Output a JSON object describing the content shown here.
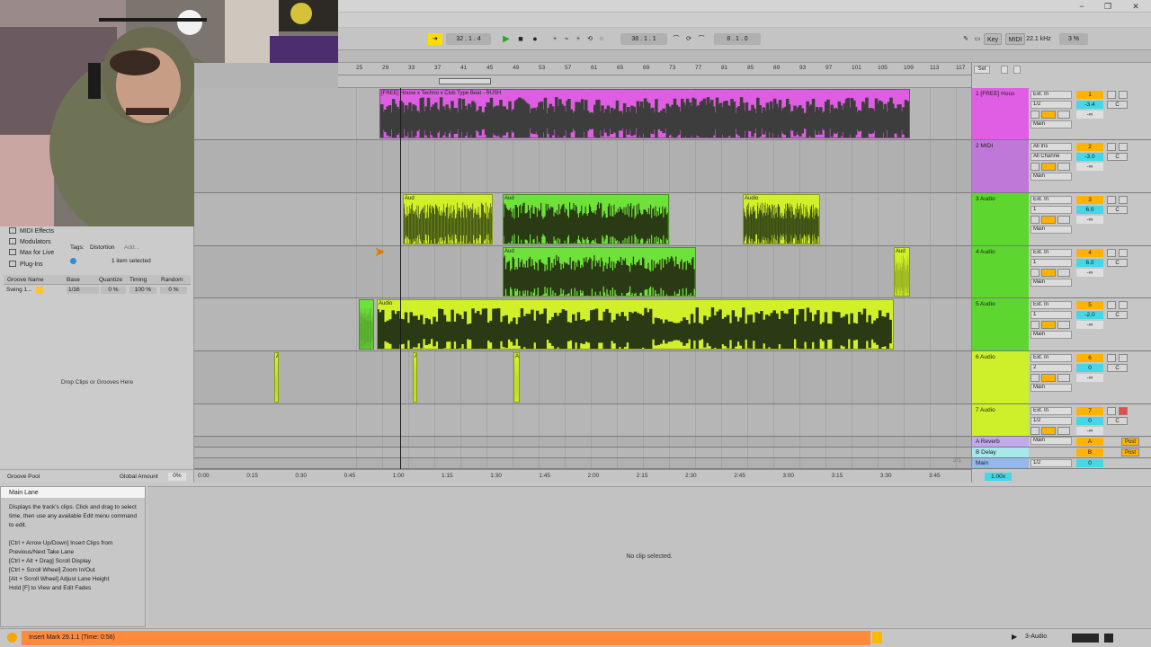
{
  "window": {
    "minimize": "−",
    "maximize": "❐",
    "close": "✕"
  },
  "transport": {
    "position": "32 .  1 .  4",
    "play_icon": "play-icon",
    "punch": "38 .  1 .  1",
    "loop_length": "8 .  1 .  0",
    "key_label": "Key",
    "midi_label": "MIDI",
    "sample_rate": "22.1 kHz",
    "cpu": "3 %"
  },
  "ruler": {
    "bars": [
      "25",
      "29",
      "33",
      "37",
      "41",
      "45",
      "49",
      "53",
      "57",
      "61",
      "65",
      "69",
      "73",
      "77",
      "81",
      "85",
      "89",
      "93",
      "97",
      "101",
      "105",
      "109",
      "113",
      "117"
    ],
    "set_label": "Set"
  },
  "timebar": {
    "times": [
      "0:00",
      "0:15",
      "0:30",
      "0:45",
      "1:00",
      "1:15",
      "1:30",
      "1:45",
      "2:00",
      "2:15",
      "2:30",
      "2:45",
      "3:00",
      "3:15",
      "3:30",
      "3:45"
    ],
    "page": "2/1"
  },
  "browser": {
    "items": [
      {
        "label": "MIDI Effects",
        "icon": "midi-effects-icon"
      },
      {
        "label": "Modulators",
        "icon": "modulators-icon"
      },
      {
        "label": "Max for Live",
        "icon": "max-for-live-icon"
      },
      {
        "label": "Plug-Ins",
        "icon": "plugins-icon"
      }
    ],
    "tags_label": "Tags:",
    "tags_value": "Distortion",
    "tags_add": "Add...",
    "selected_text": "1 item selected",
    "groove_headers": [
      "Groove Name",
      "Base",
      "Quantize",
      "Timing",
      "Random"
    ],
    "groove_row": {
      "name": "Swing 1...",
      "base": "1/16",
      "quantize": "0 %",
      "timing": "100 %",
      "random": "0 %"
    },
    "drop_text": "Drop Clips or Grooves Here",
    "groove_pool": "Groove Pool",
    "global_amount_label": "Global Amount",
    "global_amount": "0%"
  },
  "tracks": [
    {
      "name": "1 [FREE] Hous",
      "color": "#e05ee4",
      "input": "Ext. In",
      "channel": "1/2",
      "out": "Main",
      "num": "1",
      "vol": "-3.4",
      "pan": "C",
      "send": "-∞"
    },
    {
      "name": "2 MIDI",
      "color": "#c078d8",
      "input": "All Ins",
      "channel": "All Channe",
      "out": "Main",
      "num": "2",
      "vol": "-3.0",
      "pan": "C",
      "send": "-∞"
    },
    {
      "name": "3 Audio",
      "color": "#5ed630",
      "input": "Ext. In",
      "channel": "1",
      "out": "Main",
      "num": "3",
      "vol": "6.0",
      "pan": "C",
      "send": "-∞"
    },
    {
      "name": "4 Audio",
      "color": "#5ed630",
      "input": "Ext. In",
      "channel": "1",
      "out": "Main",
      "num": "4",
      "vol": "6.0",
      "pan": "C",
      "send": "-∞"
    },
    {
      "name": "5 Audio",
      "color": "#5ed630",
      "input": "Ext. In",
      "channel": "1",
      "out": "Main",
      "num": "5",
      "vol": "-2.0",
      "pan": "C",
      "send": "-∞"
    },
    {
      "name": "6 Audio",
      "color": "#cdf02a",
      "input": "Ext. In",
      "channel": "2",
      "out": "Main",
      "num": "6",
      "vol": "0",
      "pan": "C",
      "send": "-∞"
    },
    {
      "name": "7 Audio",
      "color": "#cdf02a",
      "input": "Ext. In",
      "channel": "1/2",
      "out": "Main",
      "num": "7",
      "vol": "0",
      "pan": "C",
      "send": "-∞"
    }
  ],
  "returns": [
    {
      "name": "A Reverb",
      "color": "#c2a9ec",
      "letter": "A",
      "mode": "Post"
    },
    {
      "name": "B Delay",
      "color": "#a6e8ec",
      "letter": "B",
      "mode": "Post"
    },
    {
      "name": "Main",
      "color": "#95b8ea",
      "channel": "1/2",
      "vol": "0"
    }
  ],
  "zoom": "1.00x",
  "clips": {
    "track1_title": "[FREE] House x Techno x Club Type Beat - RUSH",
    "audio_label": "Audio",
    "short_label": "Aud",
    "tiny_label": "A"
  },
  "info": {
    "title": "Main Lane",
    "body": "Displays the track's clips. Click and drag to select time, then use any available Edit menu command to edit.",
    "shortcuts": [
      "[Ctrl + Arrow Up/Down] Insert Clips from Previous/Next Take Lane",
      "[Ctrl + Alt + Drag] Scroll Display",
      "[Ctrl + Scroll Wheel] Zoom In/Out",
      "[Alt + Scroll Wheel] Adjust Lane Height",
      "Hold [F] to View and Edit Fades"
    ]
  },
  "detail": {
    "no_clip": "No clip selected."
  },
  "status": {
    "message": "Insert Mark 29.1.1 (Time: 0:56)",
    "track": "3-Audio"
  }
}
